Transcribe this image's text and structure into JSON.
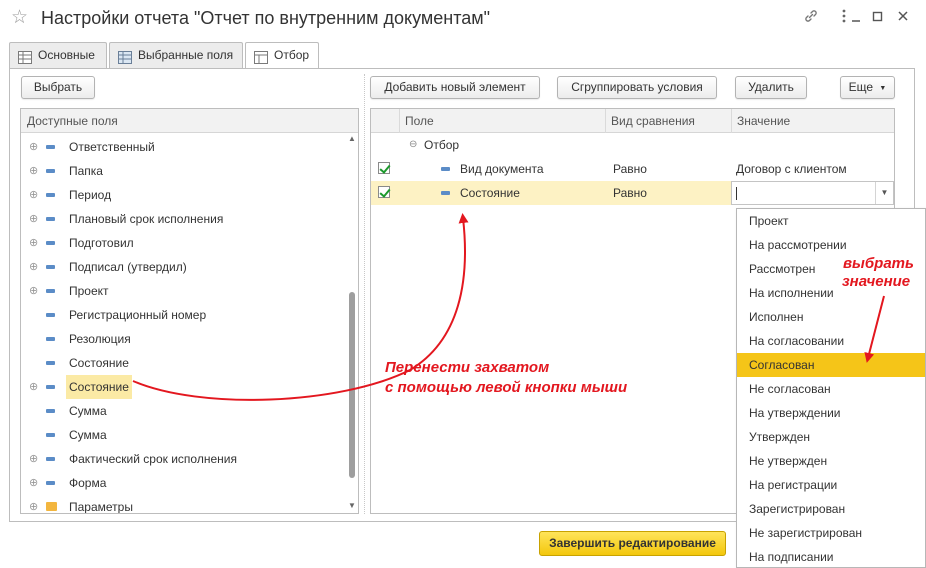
{
  "window": {
    "title": "Настройки отчета \"Отчет по внутренним документам\"",
    "star_icon": "star-icon",
    "controls": [
      "link-icon",
      "more-icon",
      "minimize-icon",
      "maximize-icon",
      "close-icon"
    ]
  },
  "tabs": [
    {
      "label": "Основные",
      "icon": "table-icon"
    },
    {
      "label": "Выбранные поля",
      "icon": "table-icon"
    },
    {
      "label": "Отбор",
      "icon": "filter-icon",
      "active": true
    }
  ],
  "left": {
    "select_button": "Выбрать",
    "header": "Доступные поля",
    "fields": [
      {
        "label": "Ответственный",
        "expandable": true,
        "icon": "field"
      },
      {
        "label": "Папка",
        "expandable": true,
        "icon": "field"
      },
      {
        "label": "Период",
        "expandable": true,
        "icon": "field"
      },
      {
        "label": "Плановый срок исполнения",
        "expandable": true,
        "icon": "field"
      },
      {
        "label": "Подготовил",
        "expandable": true,
        "icon": "field"
      },
      {
        "label": "Подписал (утвердил)",
        "expandable": true,
        "icon": "field"
      },
      {
        "label": "Проект",
        "expandable": true,
        "icon": "field"
      },
      {
        "label": "Регистрационный номер",
        "expandable": false,
        "icon": "field"
      },
      {
        "label": "Резолюция",
        "expandable": false,
        "icon": "field"
      },
      {
        "label": "Состояние",
        "expandable": false,
        "icon": "field"
      },
      {
        "label": "Состояние",
        "expandable": true,
        "icon": "field",
        "highlighted": true
      },
      {
        "label": "Сумма",
        "expandable": false,
        "icon": "field"
      },
      {
        "label": "Сумма",
        "expandable": false,
        "icon": "field"
      },
      {
        "label": "Фактический срок исполнения",
        "expandable": true,
        "icon": "field"
      },
      {
        "label": "Форма",
        "expandable": true,
        "icon": "field"
      },
      {
        "label": "Параметры",
        "expandable": true,
        "icon": "folder"
      }
    ]
  },
  "right": {
    "buttons": {
      "add": "Добавить новый элемент",
      "group": "Сгруппировать условия",
      "delete": "Удалить",
      "more": "Еще"
    },
    "columns": {
      "field": "Поле",
      "comparison": "Вид сравнения",
      "value": "Значение"
    },
    "group_label": "Отбор",
    "rows": [
      {
        "checked": true,
        "field": "Вид документа",
        "comparison": "Равно",
        "value": "Договор с клиентом"
      },
      {
        "checked": true,
        "field": "Состояние",
        "comparison": "Равно",
        "value": ""
      }
    ]
  },
  "dropdown": {
    "items": [
      "Проект",
      "На рассмотрении",
      "Рассмотрен",
      "На исполнении",
      "Исполнен",
      "На согласовании",
      "Согласован",
      "Не согласован",
      "На утверждении",
      "Утвержден",
      "Не утвержден",
      "На регистрации",
      "Зарегистрирован",
      "Не зарегистрирован",
      "На подписании"
    ],
    "highlighted_index": 6
  },
  "annotations": {
    "drag_line1": "Перенести захватом",
    "drag_line2": "с помощью левой кнопки мыши",
    "pick_line1": "выбрать",
    "pick_line2": "значение",
    "color": "#e3171f"
  },
  "footer": {
    "finish_button": "Завершить редактирование"
  },
  "colors": {
    "highlight_yellow": "#f5c518",
    "selected_row": "#fdf2c4",
    "check_green": "#1c9a2c"
  }
}
